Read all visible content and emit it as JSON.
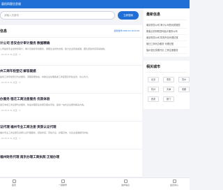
{
  "header": {
    "title": "磐阳网客信息服"
  },
  "search": {
    "placeholder": "请输入关键词",
    "button_label": "立即搜索"
  },
  "main": {
    "title": "信息",
    "meta": "最新发布 2026-10-18 21:06",
    "articles": [
      {
        "title": "计公司 咨安会计审计服务 数据精确",
        "desc": "公司提供专业的财务审计、审计及税务筹划服务，保障企业财务合规，助力企业稳健发展，团队经验丰富值得信赖。",
        "date": "· 10-18 17:10 点击：4"
      },
      {
        "title": "州工商年检登记 解答疑惑",
        "desc": "提供工商年检登记代办服务，流程简便快捷，协助企业处理各类工商变更及年检业务，省心省力。",
        "date": "· 10-18 17:11 点击：3"
      },
      {
        "title": "办服务 宿迁工商注册服务 优质体验",
        "desc": "宿迁本地工商注册代办服务，快速办理营业执照及相关手续，提供一站式企业服务解决方案。",
        "date": "· 10-18 17:11 点击：3"
      },
      {
        "title": "证代理 福州专业工商注册 资质认证代理",
        "desc": "福州专业工商注册及资质认证代理服务，经验丰富，手续齐全，办理高效，为企业发展保驾护航。",
        "date": "· 10-18 17:11 点击：1"
      },
      {
        "title": "福州财务代理 南京办理工商执照 正规办理",
        "desc": "",
        "date": ""
      }
    ]
  },
  "sidebar": {
    "latest_title": "最新信息",
    "latest_items": [
      "南京财务公司 审计公司的优质服务",
      "集客业务财税咨询会计服务公司",
      "南京财务公司 财务外包代理记账",
      "宿迁工商代办服务 代理记账",
      "福州营业执照代办 工商注册服务"
    ],
    "cities_title": "相关城市",
    "cities": [
      "北京",
      "重庆",
      "苏州",
      "杭州",
      "天津",
      "成都",
      "西安",
      "厦门"
    ]
  },
  "bottom_nav": {
    "items": [
      {
        "label": "首页",
        "icon": "home-icon"
      },
      {
        "label": "一键拨号",
        "icon": "phone-icon"
      },
      {
        "label": "发布信息",
        "icon": "edit-icon"
      },
      {
        "label": "会员中心",
        "icon": "user-icon"
      }
    ]
  },
  "colors": {
    "accent": "#1f6fd6",
    "background": "#f2f4f7"
  }
}
